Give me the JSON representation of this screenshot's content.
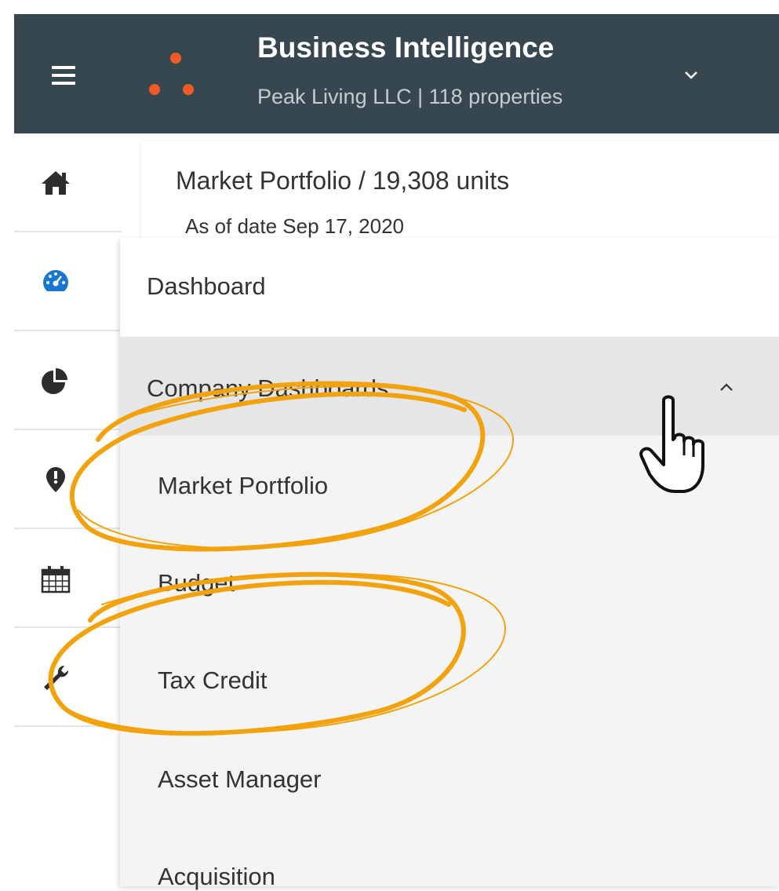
{
  "header": {
    "title": "Business Intelligence",
    "subtitle": "Peak Living LLC |  118 properties",
    "logo_color": "#f05a28",
    "menu_icon": "hamburger-menu-icon",
    "expand_icon": "chevron-down-icon"
  },
  "sidebar": {
    "items": [
      {
        "icon": "home-icon"
      },
      {
        "icon": "dashboard-gauge-icon",
        "active_color": "#1976d2"
      },
      {
        "icon": "pie-chart-icon"
      },
      {
        "icon": "alert-location-icon"
      },
      {
        "icon": "calendar-icon"
      },
      {
        "icon": "wrench-icon"
      }
    ]
  },
  "card": {
    "title": "Market Portfolio / 19,308 units",
    "as_of": "As of date Sep 17, 2020"
  },
  "menu": {
    "dashboard_label": "Dashboard",
    "group_label": "Company Dashboards",
    "group_expanded_icon": "chevron-up-icon",
    "items": [
      {
        "label": "Market Portfolio"
      },
      {
        "label": "Budget"
      },
      {
        "label": "Tax Credit"
      },
      {
        "label": "Asset Manager"
      },
      {
        "label": "Acquisition"
      }
    ]
  },
  "annotations": {
    "highlight_color": "#f2a20c",
    "circled_items": [
      "Market Portfolio",
      "Tax Credit"
    ]
  },
  "cursor": {
    "icon": "hand-pointer-icon"
  }
}
